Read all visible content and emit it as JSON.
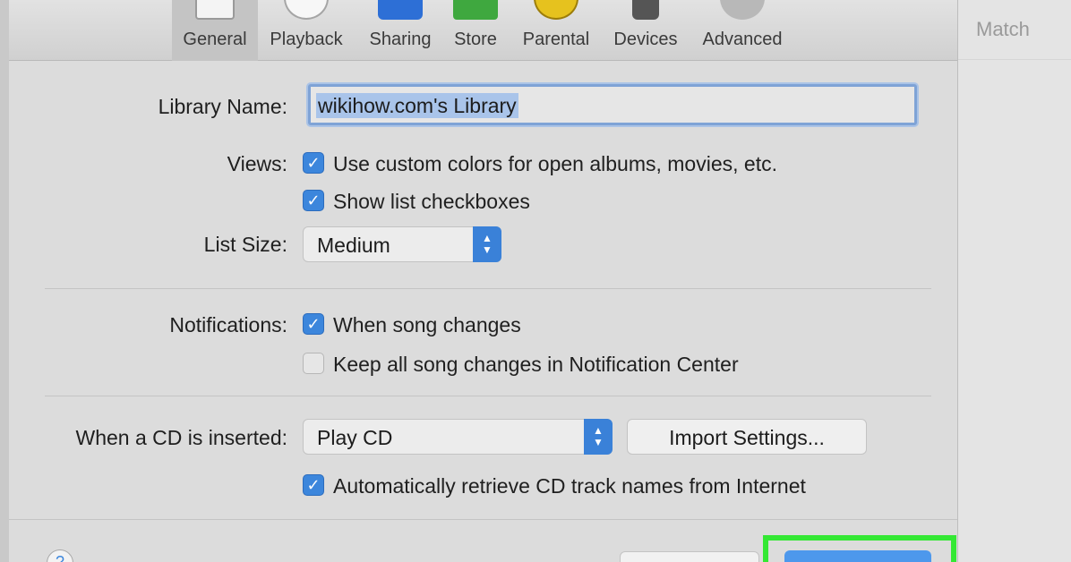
{
  "toolbar": {
    "tabs": [
      {
        "label": "General",
        "icon": "general-icon"
      },
      {
        "label": "Playback",
        "icon": "play-icon"
      },
      {
        "label": "Sharing",
        "icon": "sharing-icon"
      },
      {
        "label": "Store",
        "icon": "store-icon"
      },
      {
        "label": "Parental",
        "icon": "parental-icon"
      },
      {
        "label": "Devices",
        "icon": "devices-icon"
      },
      {
        "label": "Advanced",
        "icon": "gear-icon"
      }
    ],
    "selected": "General"
  },
  "library": {
    "label": "Library Name:",
    "value": "wikihow.com's Library"
  },
  "views": {
    "label": "Views:",
    "option1": {
      "label": "Use custom colors for open albums, movies, etc.",
      "checked": true
    },
    "option2": {
      "label": "Show list checkboxes",
      "checked": true
    }
  },
  "list_size": {
    "label": "List Size:",
    "value": "Medium"
  },
  "notifications": {
    "label": "Notifications:",
    "option1": {
      "label": "When song changes",
      "checked": true
    },
    "option2": {
      "label": "Keep all song changes in Notification Center",
      "checked": false
    }
  },
  "cd": {
    "label": "When a CD is inserted:",
    "value": "Play CD",
    "import_button": "Import Settings...",
    "auto_retrieve": {
      "label": "Automatically retrieve CD track names from Internet",
      "checked": true
    }
  },
  "background_window": {
    "match_label": "Match"
  },
  "colors": {
    "accent": "#3c86dc",
    "highlight": "#34e834"
  }
}
